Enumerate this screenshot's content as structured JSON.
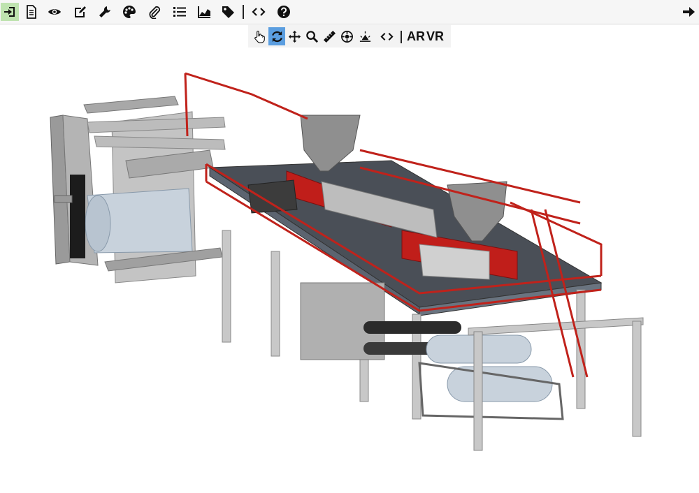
{
  "toolbar": {
    "icons": [
      "login-icon",
      "document-icon",
      "eye-icon",
      "edit-icon",
      "wrench-icon",
      "palette-icon",
      "paperclip-icon",
      "list-icon",
      "area-chart-icon",
      "tag-icon",
      "code-icon",
      "help-icon",
      "arrow-right-icon"
    ]
  },
  "viewbar": {
    "icons": [
      "hand-pointer-icon",
      "rotate-icon",
      "move-icon",
      "zoom-icon",
      "ruler-icon",
      "explode-icon",
      "light-icon",
      "code-icon"
    ],
    "ar_label": "AR",
    "vr_label": "VR"
  },
  "colors": {
    "toolbar_bg": "#f6f6f6",
    "active_green": "#bfe3b0",
    "active_blue": "#5b9ee0",
    "machine_gray": "#a9a9a9",
    "railing_red": "#c0221b",
    "roller_blue_gray": "#b5c2cf"
  }
}
